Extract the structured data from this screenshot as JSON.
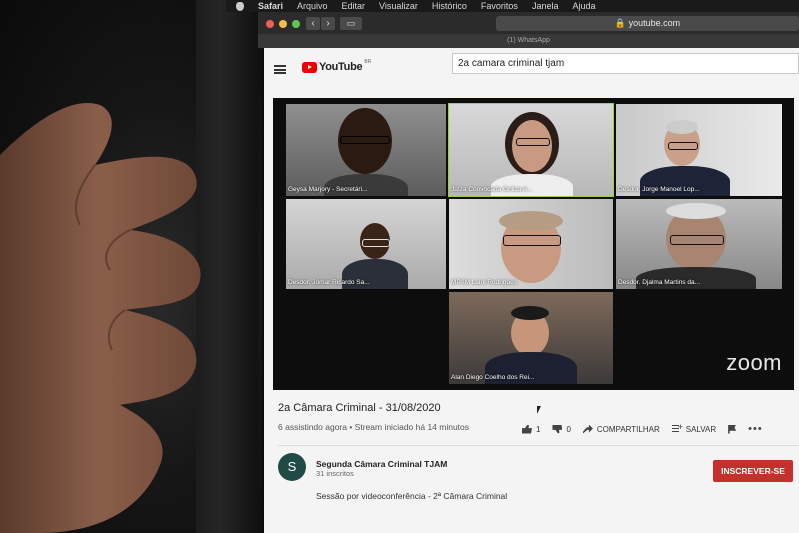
{
  "menubar": {
    "app": "Safari",
    "items": [
      "Arquivo",
      "Editar",
      "Visualizar",
      "Histórico",
      "Favoritos",
      "Janela",
      "Ajuda"
    ]
  },
  "browser": {
    "address": "youtube.com",
    "tab": "(1) WhatsApp"
  },
  "youtube": {
    "logo_text": "YouTube",
    "logo_region": "BR",
    "search_value": "2a camara criminal tjam"
  },
  "zoom": {
    "watermark": "zoom",
    "participants": [
      "Geysa Marjory - Secretári...",
      "Juíza Convocada Onilza A...",
      "Desdor. Jorge Manoel Lop...",
      "Desdor. Jomar Ricardo Sa...",
      "MPAM Liani Rodrigues",
      "Desdor. Djalma Martins da...",
      "Alan Diego Coelho dos Rei..."
    ]
  },
  "video": {
    "title": "2a Câmara Criminal - 31/08/2020",
    "meta": "6 assistindo agora • Stream iniciado há 14 minutos",
    "likes": "1",
    "dislikes": "0",
    "share_label": "COMPARTILHAR",
    "save_label": "SALVAR",
    "more": "•••"
  },
  "channel": {
    "avatar_letter": "S",
    "name": "Segunda Câmara Criminal TJAM",
    "subscribers": "31 inscritos",
    "subscribe_label": "INSCREVER-SE",
    "description": "Sessão por videoconferência - 2ª Câmara Criminal"
  },
  "colors": {
    "youtube_red": "#e00000",
    "subscribe_red": "#c4302b",
    "active_speaker": "#9ad23a"
  }
}
